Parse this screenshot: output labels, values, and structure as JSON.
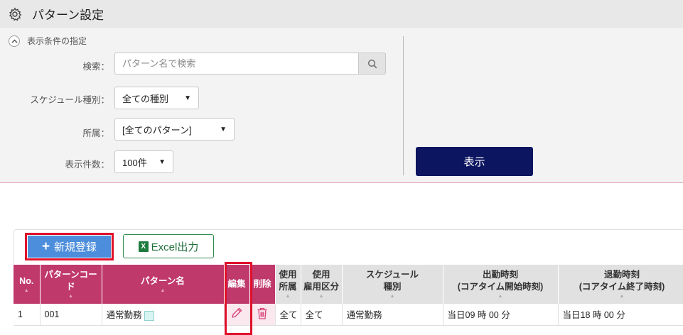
{
  "header": {
    "title": "パターン設定",
    "icon": "gear-icon"
  },
  "conditions": {
    "toggle_label": "表示条件の指定",
    "search": {
      "label": "検索：",
      "placeholder": "パターン名で検索",
      "value": ""
    },
    "schedule_type": {
      "label": "スケジュール種別：",
      "value": "全ての種別"
    },
    "affiliation": {
      "label": "所属：",
      "value": "[全てのパターン]"
    },
    "display_count": {
      "label": "表示件数：",
      "value": "100件"
    },
    "show_button": "表示"
  },
  "toolbar": {
    "new_label": "新規登録",
    "excel_label": "Excel出力"
  },
  "table": {
    "headers": {
      "no": "No.",
      "code": "パターンコード",
      "name": "パターン名",
      "edit": "編集",
      "delete": "削除",
      "use_aff_1": "使用",
      "use_aff_2": "所属",
      "use_emp_1": "使用",
      "use_emp_2": "雇用区分",
      "sched_1": "スケジュール",
      "sched_2": "種別",
      "start_1": "出勤時刻",
      "start_2": "(コアタイム開始時刻)",
      "end_1": "退勤時刻",
      "end_2": "(コアタイム終了時刻)"
    },
    "rows": [
      {
        "no": "1",
        "code": "001",
        "name": "通常勤務",
        "affiliation": "全て",
        "employment": "全て",
        "schedule": "通常勤務",
        "start": "当日09 時 00 分",
        "end": "当日18 時 00 分"
      }
    ]
  },
  "colors": {
    "header_pink": "#c0396b",
    "show_button": "#0c1560",
    "new_button": "#4d8edc",
    "highlight": "#e0102a"
  }
}
